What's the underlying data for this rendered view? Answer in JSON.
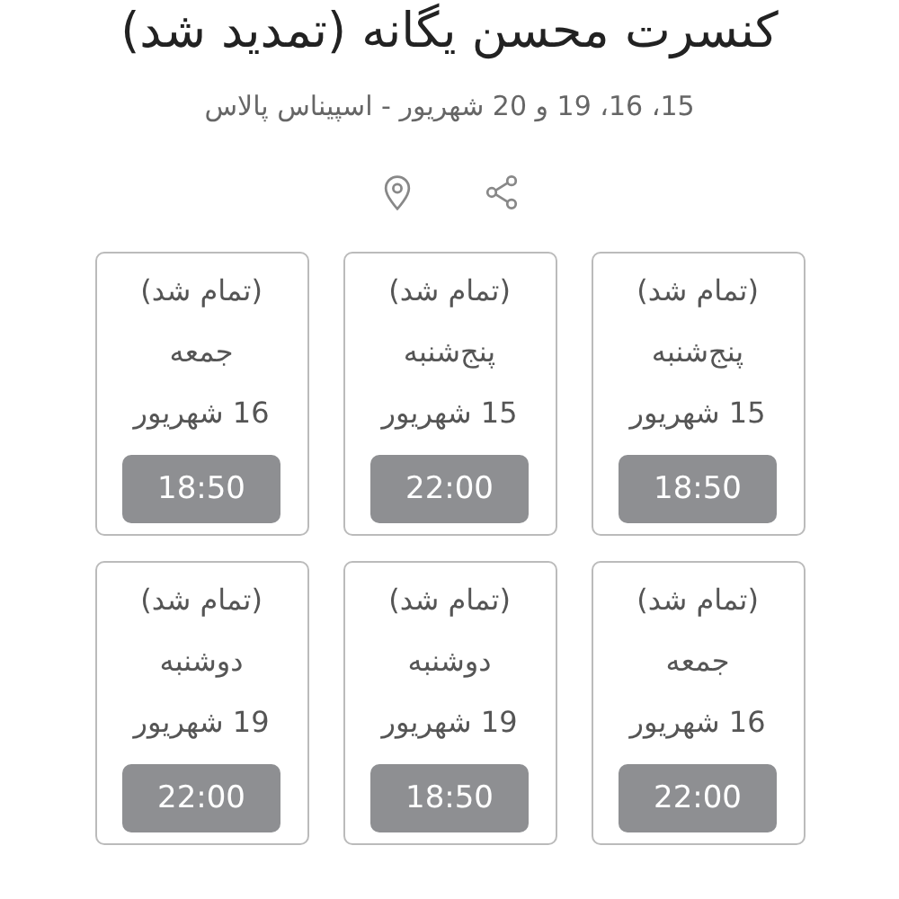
{
  "event": {
    "title": "کنسرت محسن یگانه (تمدید شد)",
    "subtitle": "15، 16، 19 و 20 شهریور - اسپیناس پالاس"
  },
  "shows": [
    {
      "note": "(تمام شد)",
      "day": "پنج‌شنبه",
      "date": "15 شهریور",
      "time": "18:50",
      "sold_out": true
    },
    {
      "note": "(تمام شد)",
      "day": "پنج‌شنبه",
      "date": "15 شهریور",
      "time": "22:00",
      "sold_out": true
    },
    {
      "note": "(تمام شد)",
      "day": "جمعه",
      "date": "16 شهریور",
      "time": "18:50",
      "sold_out": true
    },
    {
      "note": "(تمام شد)",
      "day": "جمعه",
      "date": "16 شهریور",
      "time": "22:00",
      "sold_out": true
    },
    {
      "note": "(تمام شد)",
      "day": "دوشنبه",
      "date": "19 شهریور",
      "time": "18:50",
      "sold_out": true
    },
    {
      "note": "(تمام شد)",
      "day": "دوشنبه",
      "date": "19 شهریور",
      "time": "22:00",
      "sold_out": true
    }
  ]
}
